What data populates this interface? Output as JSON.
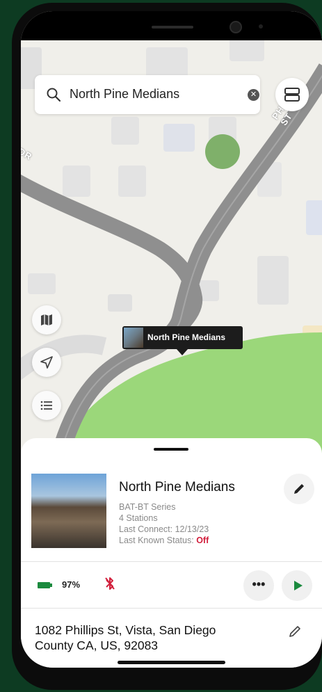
{
  "search": {
    "query": "North Pine Medians"
  },
  "map": {
    "road_labels": [
      "PHILLIPS ST",
      "DR"
    ],
    "marker_label": "North Pine Medians"
  },
  "controller": {
    "name": "North Pine Medians",
    "series": "BAT-BT Series",
    "stations": "4 Stations",
    "last_connect": "Last Connect: 12/13/23",
    "last_status_label": "Last Known Status:",
    "last_status_value": "Off",
    "battery": "97%",
    "more_label": "•••",
    "address": "1082 Phillips St, Vista, San Diego County CA, US, 92083"
  },
  "colors": {
    "brand_green": "#1b8a3e",
    "status_off": "#d21f3c",
    "frame": "#0d3b22"
  },
  "icons": [
    "search-icon",
    "clear-icon",
    "layers-icon",
    "map-icon",
    "location-arrow-icon",
    "list-icon",
    "pencil-icon",
    "battery-icon",
    "bluetooth-off-icon",
    "more-icon",
    "play-icon"
  ]
}
